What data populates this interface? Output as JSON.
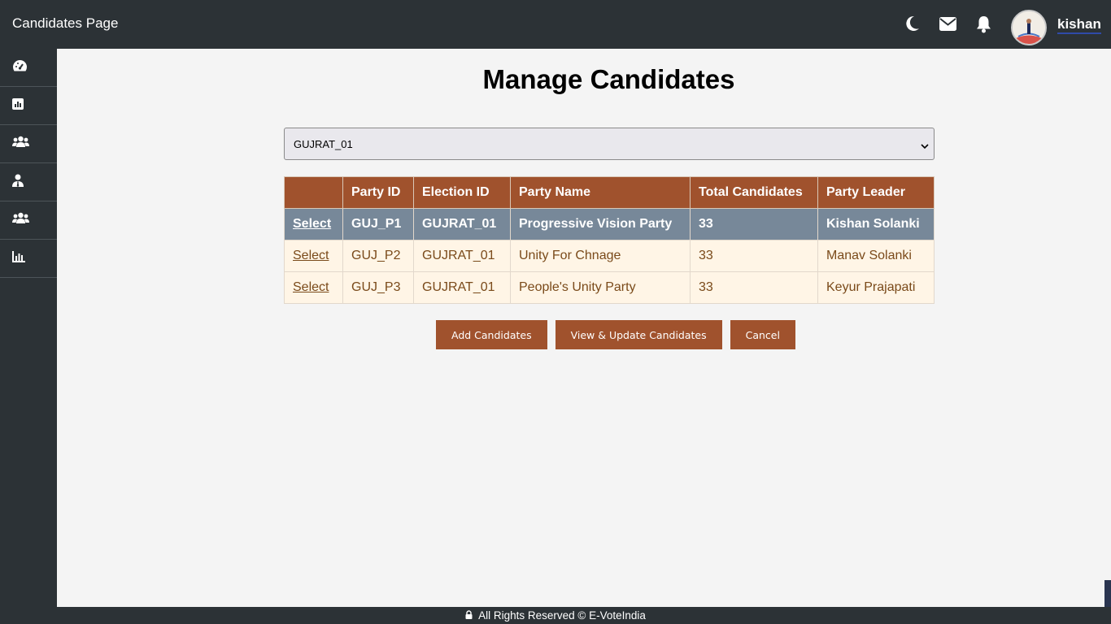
{
  "header": {
    "title": "Candidates Page",
    "username": "kishan",
    "icons": [
      "moon-icon",
      "envelope-icon",
      "bell-icon"
    ]
  },
  "sidebar": {
    "items": [
      {
        "icon": "dashboard-gauge-icon"
      },
      {
        "icon": "bar-chart-icon"
      },
      {
        "icon": "users-group-icon"
      },
      {
        "icon": "user-tie-icon"
      },
      {
        "icon": "users-icon"
      },
      {
        "icon": "chart-bars-icon"
      }
    ]
  },
  "main": {
    "title": "Manage Candidates",
    "election_select": {
      "value": "GUJRAT_01"
    },
    "table": {
      "headers": [
        "",
        "Party ID",
        "Election ID",
        "Party Name",
        "Total Candidates",
        "Party Leader"
      ],
      "rows": [
        {
          "action": "Select",
          "party_id": "GUJ_P1",
          "election_id": "GUJRAT_01",
          "party_name": "Progressive Vision Party",
          "total": "33",
          "leader": "Kishan Solanki",
          "selected": true
        },
        {
          "action": "Select",
          "party_id": "GUJ_P2",
          "election_id": "GUJRAT_01",
          "party_name": "Unity For Chnage",
          "total": "33",
          "leader": "Manav Solanki",
          "selected": false
        },
        {
          "action": "Select",
          "party_id": "GUJ_P3",
          "election_id": "GUJRAT_01",
          "party_name": "People's Unity Party",
          "total": "33",
          "leader": "Keyur Prajapati",
          "selected": false
        }
      ]
    },
    "buttons": {
      "add": "Add Candidates",
      "view_update": "View & Update Candidates",
      "cancel": "Cancel"
    }
  },
  "footer": {
    "text": "All Rights Reserved © E-VoteIndia"
  },
  "colors": {
    "header_bg": "#2c3236",
    "accent": "#a0522d",
    "selected_row": "#778899",
    "row_bg": "#fff5e6"
  }
}
